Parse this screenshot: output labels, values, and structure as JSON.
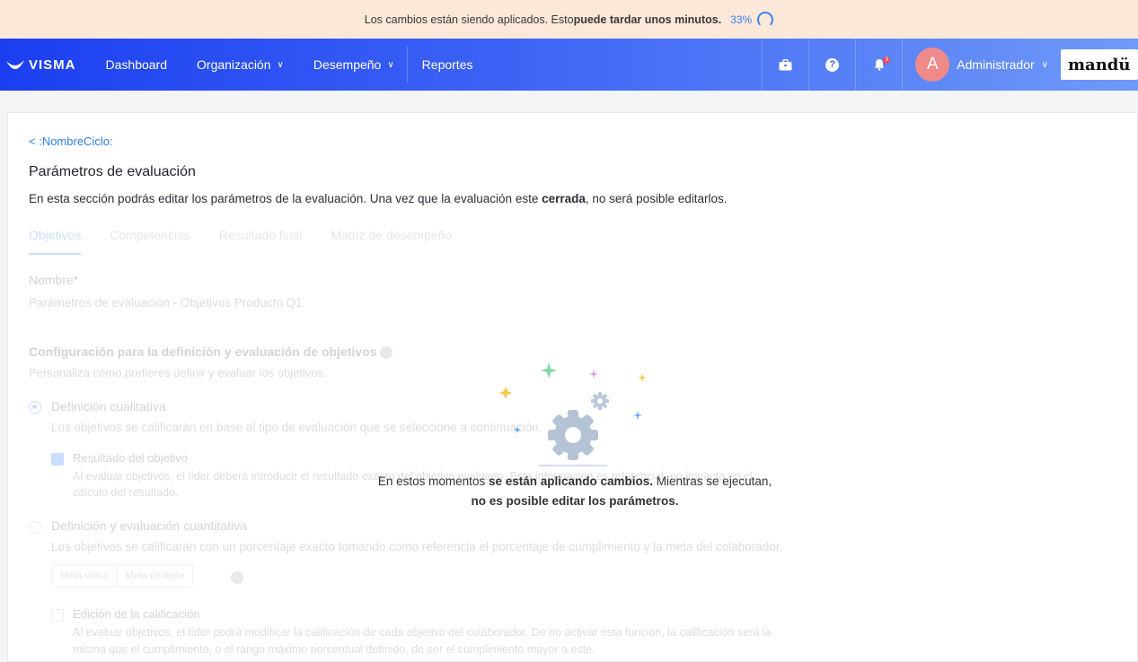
{
  "banner": {
    "text_before": "Los cambios están siendo aplicados. Esto ",
    "text_bold": "puede tardar unos minutos.",
    "progress": "33%"
  },
  "nav": {
    "logo": "VISMA",
    "items": [
      {
        "label": "Dashboard",
        "has_dropdown": false
      },
      {
        "label": "Organización",
        "has_dropdown": true
      },
      {
        "label": "Desempeño",
        "has_dropdown": true
      },
      {
        "label": "Reportes",
        "has_dropdown": false
      }
    ],
    "help_glyph": "?",
    "notification_count": "3",
    "user_initial": "A",
    "user_name": "Administrador",
    "brand": "mandü"
  },
  "page": {
    "back_link": "< :NombreCiclo:",
    "title": "Parámetros de evaluación",
    "desc_before": "En esta sección podrás editar los parámetros de la evaluación. Una vez que la evaluación este ",
    "desc_bold": "cerrada",
    "desc_after": ", no será posible editarlos."
  },
  "tabs": [
    "Objetivos",
    "Competencias",
    "Resultado final",
    "Matriz de desempeño"
  ],
  "form": {
    "name_label": "Nombre*",
    "name_value": "Parámetros de evaluación - Objetivos Producto Q1",
    "config_title": "Configuración para la definición y evaluación de objetivos",
    "config_sub": "Personaliza cómo prefieres definir y evaluar los objetivos.",
    "qual_label": "Definición cualitativa",
    "qual_sub": "Los objetivos se calificarán en base al tipo de evaluación que se seleccione a continuación.",
    "result_label": "Resultado del objetivo",
    "result_sub1": "Al evaluar objetivos, el líder deberá introducir el resultado exacto del objetivo evaluado. Esta información es referencial, no impacta en el",
    "result_sub2": "cálculo del resultado.",
    "quant_label": "Definición y evaluación cuantitativa",
    "quant_sub": "Los objetivos se calificarán con un porcentaje exacto tomando como referencia el porcentaje de cumplimiento y la meta del colaborador.",
    "seg_single": "Meta única",
    "seg_multi": "Meta múltiple",
    "edit_label": "Edición de la calificación",
    "edit_sub1": "Al evaluar objetivos, el líder podrá modificar la calificación de cada objetivo del colaborador. De no activar esta función, la calificación será la",
    "edit_sub2": "misma que el cumplimiento, o el rango máximo porcentual definido, de ser el cumplimiento mayor a este."
  },
  "overlay": {
    "msg_1": "En estos momentos ",
    "msg_bold_1": "se están aplicando cambios.",
    "msg_2": " Mientras se ejecutan, ",
    "msg_bold_2": "no es posible editar los parámetros."
  }
}
